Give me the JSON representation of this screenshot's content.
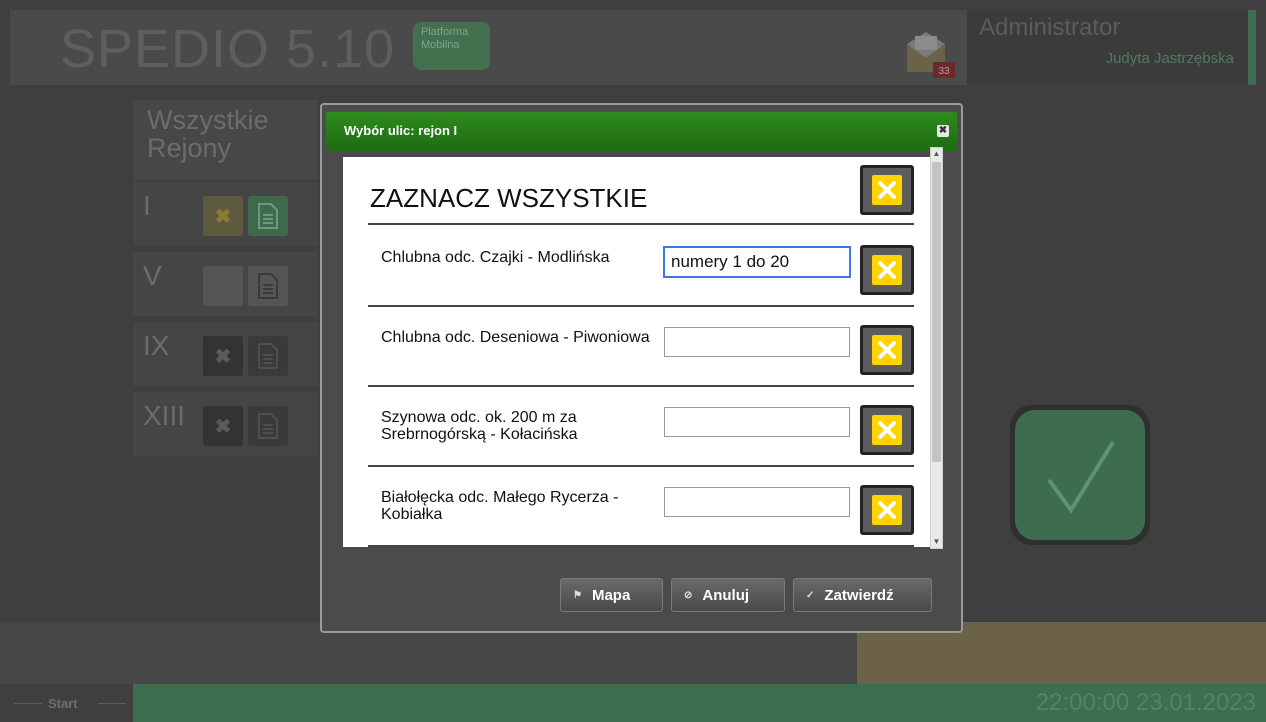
{
  "app": {
    "title": "SPEDIO 5.10",
    "badge_line1": "Platforma",
    "badge_line2": "Mobilna",
    "mail_count": "33"
  },
  "user": {
    "role": "Administrator",
    "name": "Judyta Jastrzębska"
  },
  "regions": {
    "header_line1": "Wszystkie",
    "header_line2": "Rejony",
    "items": [
      {
        "label": "I"
      },
      {
        "label": "V"
      },
      {
        "label": "IX"
      },
      {
        "label": "XIII"
      }
    ]
  },
  "dialog": {
    "title": "Wybór ulic: rejon I",
    "select_all": "ZAZNACZ WSZYSTKIE",
    "streets": [
      {
        "name": "Chlubna odc. Czajki - Modlińska",
        "value": "numery 1 do 20"
      },
      {
        "name": "Chlubna odc. Deseniowa - Piwoniowa",
        "value": ""
      },
      {
        "name": "Szynowa odc. ok. 200 m za Srebrnogórską - Kołacińska",
        "value": ""
      },
      {
        "name": "Białołęcka odc. Małego Rycerza - Kobiałka",
        "value": ""
      }
    ],
    "buttons": {
      "map": "Mapa",
      "cancel": "Anuluj",
      "confirm": "Zatwierdź"
    }
  },
  "statusbar": {
    "start": "Start",
    "time": "22:00:00",
    "date": "23.01.2023"
  },
  "colors": {
    "green_accent": "#3d6e4d",
    "dialog_title": "#1f6c13",
    "x_button": "#ffd200"
  }
}
